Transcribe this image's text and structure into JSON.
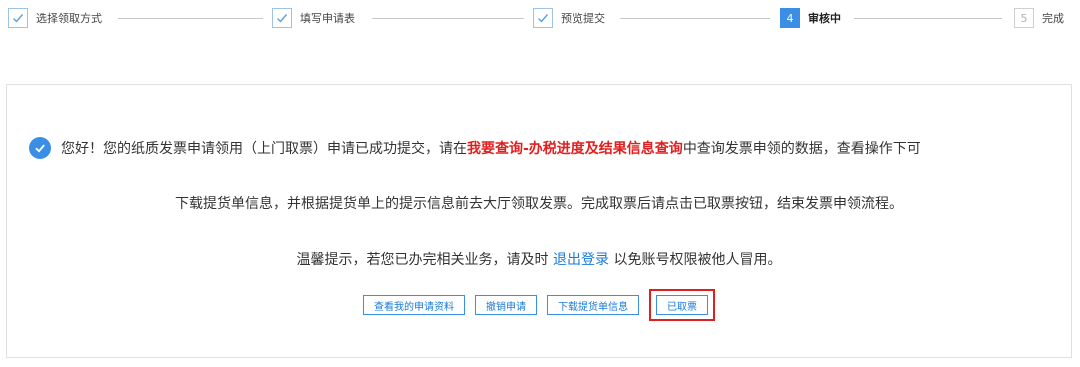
{
  "stepper": {
    "steps": [
      {
        "label": "选择领取方式",
        "status": "done",
        "number": ""
      },
      {
        "label": "填写申请表",
        "status": "done",
        "number": ""
      },
      {
        "label": "预览提交",
        "status": "done",
        "number": ""
      },
      {
        "label": "审核中",
        "status": "current",
        "number": "4"
      },
      {
        "label": "完成",
        "status": "pending",
        "number": "5"
      }
    ]
  },
  "message": {
    "line1_prefix": "您好！您的纸质发票申请领用（上门取票）申请已成功提交，请在",
    "line1_highlight": "我要查询-办税进度及结果信息查询",
    "line1_suffix": "中查询发票申领的数据，查看操作下可",
    "line2": "下载提货单信息，并根据提货单上的提示信息前去大厅领取发票。完成取票后请点击已取票按钮，结束发票申领流程。",
    "line3_prefix": "温馨提示，若您已办完相关业务，请及时",
    "line3_link": "退出登录",
    "line3_suffix": "以免账号权限被他人冒用。"
  },
  "buttons": {
    "view_application": "查看我的申请资料",
    "cancel_application": "撤销申请",
    "download_delivery": "下载提货单信息",
    "picked_up": "已取票"
  },
  "colors": {
    "accent": "#3a8ee6",
    "highlight": "#e02020",
    "link": "#1a7bd8"
  },
  "icons": {
    "done_step": "check-icon",
    "success": "check-circle-icon"
  }
}
